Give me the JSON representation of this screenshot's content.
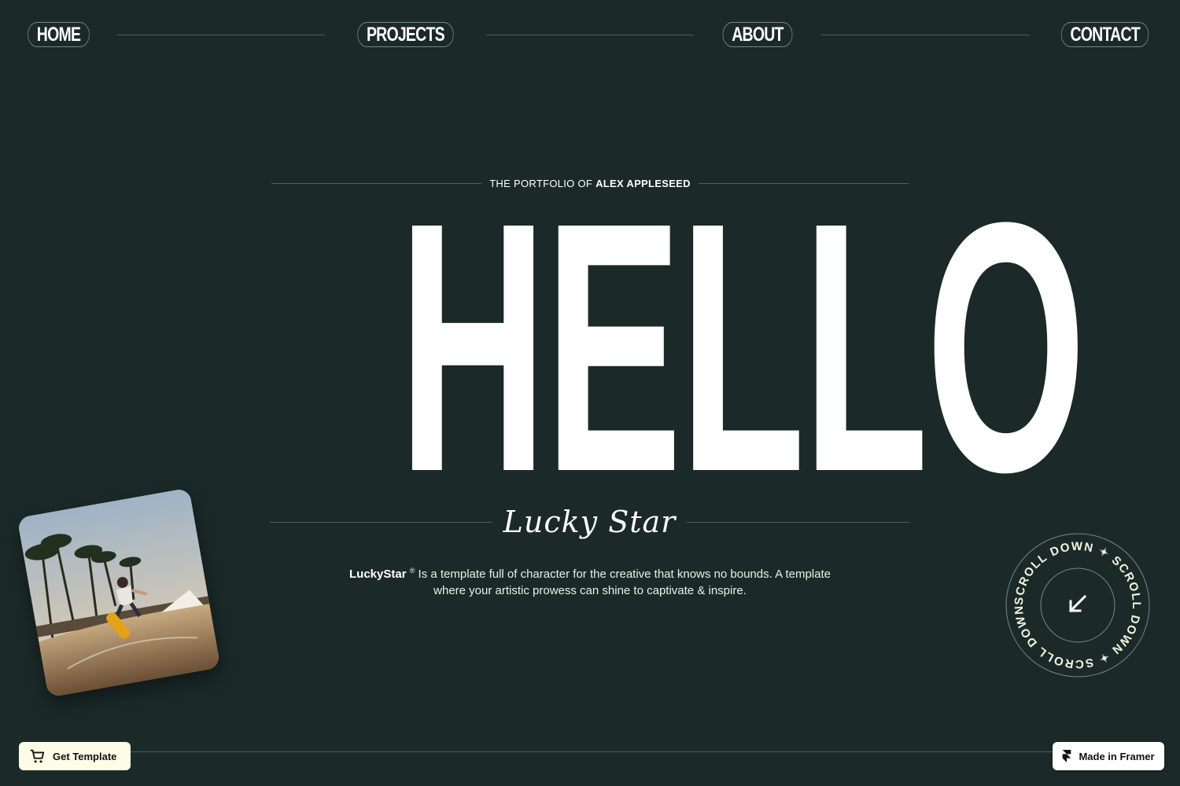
{
  "nav": {
    "items": [
      {
        "label": "HOME"
      },
      {
        "label": "PROJECTS"
      },
      {
        "label": "ABOUT"
      },
      {
        "label": "CONTACT"
      }
    ]
  },
  "hero": {
    "kicker_prefix": "THE PORTFOLIO OF",
    "kicker_name": "ALEX APPLESEED",
    "headline": "HELLO",
    "script_title": "Lucky Star",
    "desc_brand": "LuckyStar",
    "desc_mark": "®",
    "desc_text": " Is a template full of character for the creative that knows no bounds. A template where your artistic prowess can shine to captivate & inspire."
  },
  "scroll_badge": {
    "ring_text": "SCROLL DOWN ✦ SCROLL DOWN ✦ SCROLL DOWN ✦",
    "icon": "arrow-down-left-icon"
  },
  "footer": {
    "get_template_label": "Get Template",
    "get_template_icon": "cart-icon",
    "framer_label": "Made in Framer",
    "framer_icon": "framer-logo-icon"
  },
  "colors": {
    "background": "#1b2a29",
    "line": "#456460",
    "pill_border": "#6f8a82",
    "text": "#ffffff",
    "cream_button": "#fbfde6"
  }
}
